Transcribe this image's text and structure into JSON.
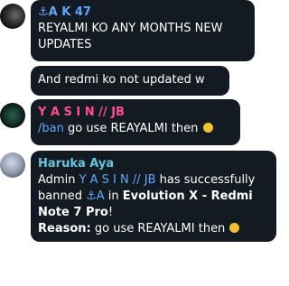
{
  "messages": [
    {
      "sender_anchor": "⚓",
      "sender_name": "A K 47",
      "line1": "REYALMI KO ANY MONTHS NEW",
      "line2": "UPDATES"
    },
    {
      "line1": "And redmi ko not updated w"
    },
    {
      "sender": "Y A S I N // JB",
      "command": "/ban",
      "text": " go use REAYALMI then "
    },
    {
      "sender": "Haruka Aya",
      "admin_label": "Admin ",
      "admin_user": "Y A S I N // JB",
      "has_banned": " has successfully",
      "banned_word": "banned ",
      "banned_user": "⚓A",
      "in_word": " in ",
      "group_part1": "Evolution X - Redmi",
      "group_part2": "Note 7 Pro",
      "exclaim": "!",
      "reason_label": "Reason:",
      "reason_text": " go use REAYALMI then "
    }
  ],
  "colors": {
    "bubble": "#141a22",
    "anchor_name": "#5ea8ff",
    "yasin": "#ff4d8d",
    "haruka": "#65c8de",
    "link": "#5ea8ff"
  },
  "icons": [
    "avatar",
    "smirk-emoji"
  ]
}
